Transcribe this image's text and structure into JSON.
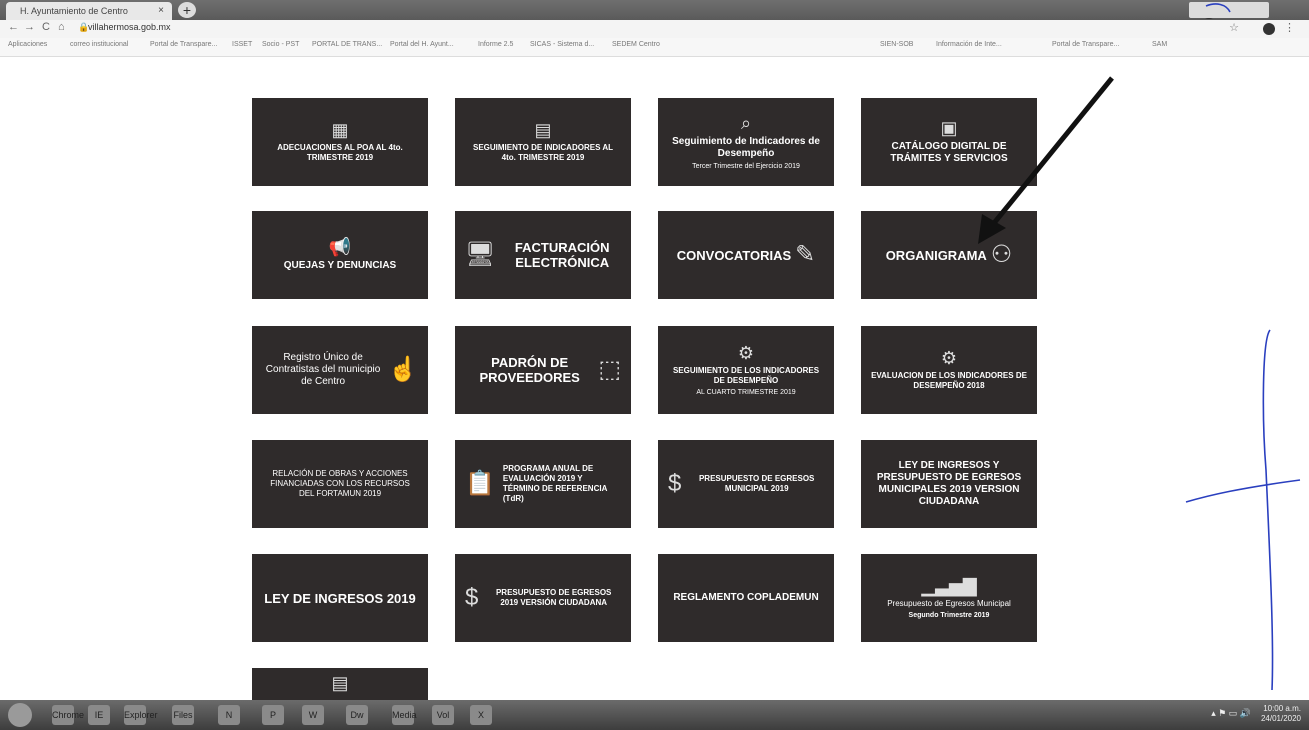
{
  "browser": {
    "tab_title": "H. Ayuntamiento de Centro",
    "tab_close": "×",
    "new_tab": "+",
    "url": "villahermosa.gob.mx",
    "nav_back": "←",
    "nav_forward": "→",
    "nav_reload": "C",
    "nav_home": "⌂",
    "bookmarks": [
      "Aplicaciones",
      "correo institucional",
      "Portal de Transpare...",
      "ISSET",
      "Socio - PST",
      "PORTAL DE TRANS...",
      "Portal del H. Ayunt...",
      "Informe 2.5",
      "SICAS - Sistema d...",
      "SEDEM Centro",
      "SIEN-SOB",
      "Información de Inte...",
      "Portal de Transpare...",
      "SAM"
    ]
  },
  "tiles": [
    {
      "label": "ADECUACIONES AL POA AL 4to. TRIMESTRE 2019",
      "icon": "chart-doc-icon"
    },
    {
      "label": "SEGUIMIENTO DE INDICADORES AL 4to. TRIMESTRE 2019",
      "icon": "document-icon"
    },
    {
      "label": "Seguimiento de Indicadores de Desempeño",
      "sub": "Tercer Trimestre del Ejercicio 2019",
      "icon": "monitor-search-icon"
    },
    {
      "label": "CATÁLOGO DIGITAL DE TRÁMITES Y SERVICIOS",
      "icon": "catalog-icon"
    },
    {
      "label": "QUEJAS Y DENUNCIAS",
      "icon": "megaphone-icon"
    },
    {
      "label": "FACTURACIÓN ELECTRÓNICA",
      "icon": "computer-icon"
    },
    {
      "label": "CONVOCATORIAS",
      "icon": "edit-doc-icon"
    },
    {
      "label": "ORGANIGRAMA",
      "icon": "org-chart-icon"
    },
    {
      "label": "Registro Único de Contratistas del municipio de Centro",
      "icon": "pointer-hand-icon"
    },
    {
      "label": "PADRÓN DE PROVEEDORES",
      "icon": "box-hand-icon"
    },
    {
      "label": "SEGUIMIENTO DE LOS INDICADORES DE DESEMPEÑO",
      "sub": "AL CUARTO TRIMESTRE 2019",
      "icon": "gear-doc-icon"
    },
    {
      "label": "EVALUACION DE LOS INDICADORES DE DESEMPEÑO 2018",
      "icon": "gear-doc-icon"
    },
    {
      "label": "RELACIÓN DE OBRAS Y ACCIONES FINANCIADAS CON LOS RECURSOS DEL FORTAMUN 2019",
      "icon": ""
    },
    {
      "label": "PROGRAMA ANUAL DE EVALUACIÓN 2019 Y TÉRMINO DE REFERENCIA (TdR)",
      "icon": "clipboard-icon"
    },
    {
      "label": "PRESUPUESTO DE EGRESOS MUNICIPAL 2019",
      "icon": "money-hand-icon"
    },
    {
      "label": "LEY DE INGRESOS Y PRESUPUESTO DE EGRESOS MUNICIPALES 2019 VERSION CIUDADANA",
      "icon": ""
    },
    {
      "label": "LEY DE INGRESOS 2019",
      "icon": ""
    },
    {
      "label": "PRESUPUESTO DE EGRESOS 2019 VERSIÓN CIUDADANA",
      "icon": "money-hand-icon"
    },
    {
      "label": "REGLAMENTO COPLADEMUN",
      "icon": ""
    },
    {
      "label": "Presupuesto de Egresos Municipal",
      "sub": "Segundo Trimestre 2019",
      "icon": "bar-chart-icon"
    },
    {
      "label": "",
      "icon": "document-icon"
    }
  ],
  "taskbar": {
    "apps": [
      "Chrome",
      "IE",
      "Explorer",
      "Files",
      "N",
      "P",
      "W",
      "Dw",
      "Media",
      "Vol",
      "X"
    ],
    "clock_time": "10:00 a.m.",
    "clock_date": "24/01/2020"
  },
  "colors": {
    "tile_bg": "#2f2b2b",
    "annotation_arrow": "#111111",
    "signature_ink": "#2a3fbf"
  }
}
